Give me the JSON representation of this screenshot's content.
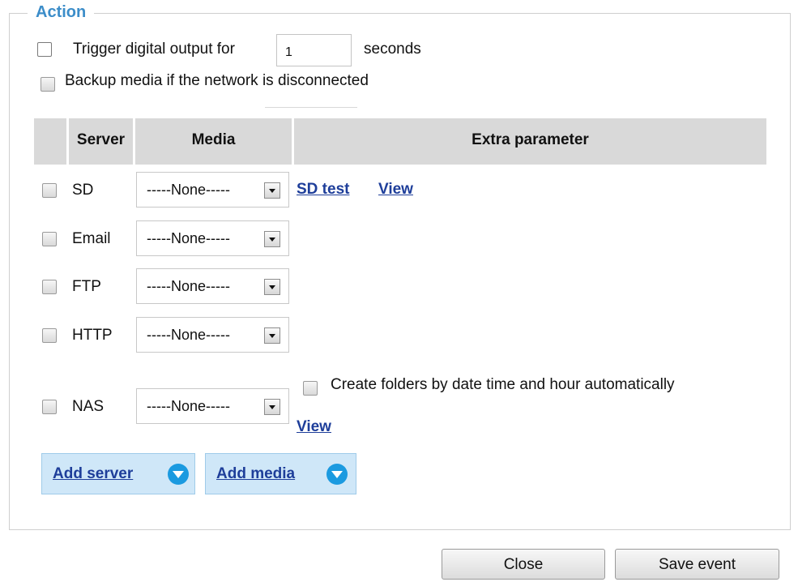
{
  "fieldset": {
    "legend": "Action"
  },
  "trigger": {
    "label": "Trigger digital output for",
    "value": "1",
    "unit": "seconds",
    "checked": false
  },
  "backup": {
    "label": "Backup media if the network is disconnected",
    "checked": false
  },
  "table": {
    "headers": {
      "server": "Server",
      "media": "Media",
      "extra": "Extra parameter"
    },
    "rows": [
      {
        "server": "SD",
        "media": "-----None-----",
        "links": [
          "SD test",
          "View"
        ]
      },
      {
        "server": "Email",
        "media": "-----None-----"
      },
      {
        "server": "FTP",
        "media": "-----None-----"
      },
      {
        "server": "HTTP",
        "media": "-----None-----"
      },
      {
        "server": "NAS",
        "media": "-----None-----",
        "option": "Create folders by date time and hour automatically",
        "link": "View"
      }
    ]
  },
  "add": {
    "server_label": "Add server",
    "media_label": "Add media"
  },
  "buttons": {
    "close": "Close",
    "save": "Save event"
  }
}
